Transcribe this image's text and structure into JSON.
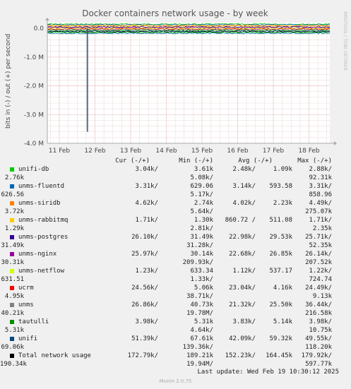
{
  "chart_data": {
    "type": "line",
    "title": "Docker containers network usage - by week",
    "ylabel": "bits in (-) / out (+) per second",
    "xlabel": "",
    "side_label": "RRDTOOL / TOBI OETIKER",
    "x_ticks": [
      "11 Feb",
      "12 Feb",
      "13 Feb",
      "14 Feb",
      "15 Feb",
      "16 Feb",
      "17 Feb",
      "18 Feb"
    ],
    "y_ticks": [
      "0.0",
      "-1.0 M",
      "-2.0 M",
      "-3.0 M",
      "-4.0 M"
    ],
    "ylim": [
      -4000000,
      200000
    ],
    "grid": true,
    "spike": {
      "x": "11 Feb 19:00",
      "value": -3600000,
      "series": "unifi"
    },
    "columns": [
      "Cur (-/+)",
      "Min (-/+)",
      "Avg (-/+)",
      "Max (-/+)"
    ],
    "series": [
      {
        "name": "unifi-db",
        "color": "#00cc00",
        "cur": [
          "3.04k/",
          "2.76k"
        ],
        "min": [
          "3.61k",
          "5.08k/"
        ],
        "avg": [
          "2.48k/",
          "1.09k"
        ],
        "max": [
          "2.88k/",
          "92.31k"
        ]
      },
      {
        "name": "unms-fluentd",
        "color": "#0066b3",
        "cur": [
          "3.31k/",
          "626.56"
        ],
        "min": [
          "629.06",
          "5.17k/"
        ],
        "avg": [
          "3.14k/",
          "593.58"
        ],
        "max": [
          "3.31k/",
          "858.96"
        ]
      },
      {
        "name": "unms-siridb",
        "color": "#ff8000",
        "cur": [
          "4.62k/",
          "3.72k"
        ],
        "min": [
          "2.74k",
          "5.64k/"
        ],
        "avg": [
          "4.02k/",
          "2.23k"
        ],
        "max": [
          "4.49k/",
          "275.07k"
        ]
      },
      {
        "name": "unms-rabbitmq",
        "color": "#ffcc00",
        "cur": [
          "1.71k/",
          "1.29k"
        ],
        "min": [
          "1.30k",
          "2.81k/"
        ],
        "avg": [
          "860.72 /",
          "511.08"
        ],
        "max": [
          "1.71k/",
          "2.35k"
        ]
      },
      {
        "name": "unms-postgres",
        "color": "#330099",
        "cur": [
          "26.10k/",
          "31.49k"
        ],
        "min": [
          "31.49k",
          "31.28k/"
        ],
        "avg": [
          "22.98k/",
          "29.53k"
        ],
        "max": [
          "25.71k/",
          "52.35k"
        ]
      },
      {
        "name": "unms-nginx",
        "color": "#990099",
        "cur": [
          "25.97k/",
          "30.31k"
        ],
        "min": [
          "30.14k",
          "209.93k/"
        ],
        "avg": [
          "22.68k/",
          "26.85k"
        ],
        "max": [
          "26.14k/",
          "207.52k"
        ]
      },
      {
        "name": "unms-netflow",
        "color": "#ccff00",
        "cur": [
          "1.23k/",
          "631.51"
        ],
        "min": [
          "633.34",
          "1.33k/"
        ],
        "avg": [
          "1.12k/",
          "537.17"
        ],
        "max": [
          "1.22k/",
          "724.74"
        ]
      },
      {
        "name": "ucrm",
        "color": "#ff0000",
        "cur": [
          "24.56k/",
          "4.95k"
        ],
        "min": [
          "5.06k",
          "38.71k/"
        ],
        "avg": [
          "23.04k/",
          "4.16k"
        ],
        "max": [
          "24.49k/",
          "9.13k"
        ]
      },
      {
        "name": "unms",
        "color": "#808080",
        "cur": [
          "26.86k/",
          "40.21k"
        ],
        "min": [
          "40.73k",
          "19.78M/"
        ],
        "avg": [
          "21.32k/",
          "25.50k"
        ],
        "max": [
          "36.44k/",
          "216.58k"
        ]
      },
      {
        "name": "tautulli",
        "color": "#008f00",
        "cur": [
          "3.98k/",
          "5.31k"
        ],
        "min": [
          "5.31k",
          "4.64k/"
        ],
        "avg": [
          "3.83k/",
          "5.14k"
        ],
        "max": [
          "3.98k/",
          "10.75k"
        ]
      },
      {
        "name": "unifi",
        "color": "#00487d",
        "cur": [
          "51.39k/",
          "69.06k"
        ],
        "min": [
          "67.61k",
          "139.36k/"
        ],
        "avg": [
          "42.09k/",
          "59.32k"
        ],
        "max": [
          "49.55k/",
          "118.20k"
        ]
      },
      {
        "name": "Total network usage",
        "color": "#000000",
        "cur": [
          "172.79k/",
          "190.34k"
        ],
        "min": [
          "189.21k",
          "19.94M/"
        ],
        "avg": [
          "152.23k/",
          "164.45k"
        ],
        "max": [
          "179.92k/",
          "597.77k"
        ]
      }
    ],
    "last_update": "Last update: Wed Feb 19 10:30:12 2025",
    "footer": "Munin 2.0.75"
  }
}
